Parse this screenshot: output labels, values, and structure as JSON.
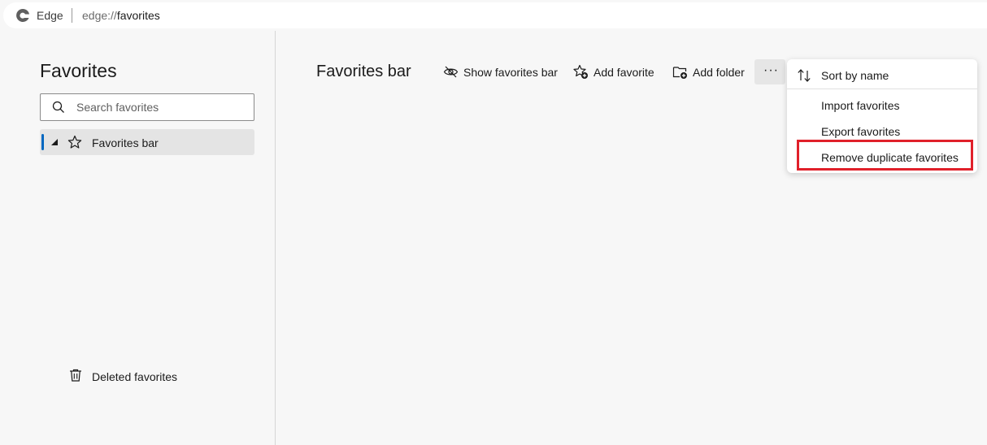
{
  "browser": {
    "site_label": "Edge",
    "url_scheme": "edge://",
    "url_host": "favorites"
  },
  "sidebar": {
    "title": "Favorites",
    "search_placeholder": "Search favorites",
    "tree_items": [
      {
        "label": "Favorites bar",
        "expanded": true,
        "selected": true
      }
    ],
    "deleted_label": "Deleted favorites"
  },
  "main": {
    "title": "Favorites bar",
    "toolbar": {
      "show_bar": "Show favorites bar",
      "add_favorite": "Add favorite",
      "add_folder": "Add folder",
      "more": "···"
    }
  },
  "menu": {
    "items": [
      {
        "label": "Sort by name",
        "icon": "sort-icon"
      },
      {
        "label": "Import favorites"
      },
      {
        "label": "Export favorites"
      },
      {
        "label": "Remove duplicate favorites",
        "highlighted": true
      }
    ]
  },
  "colors": {
    "accent": "#0067c0",
    "highlight_border": "#e0202a"
  }
}
